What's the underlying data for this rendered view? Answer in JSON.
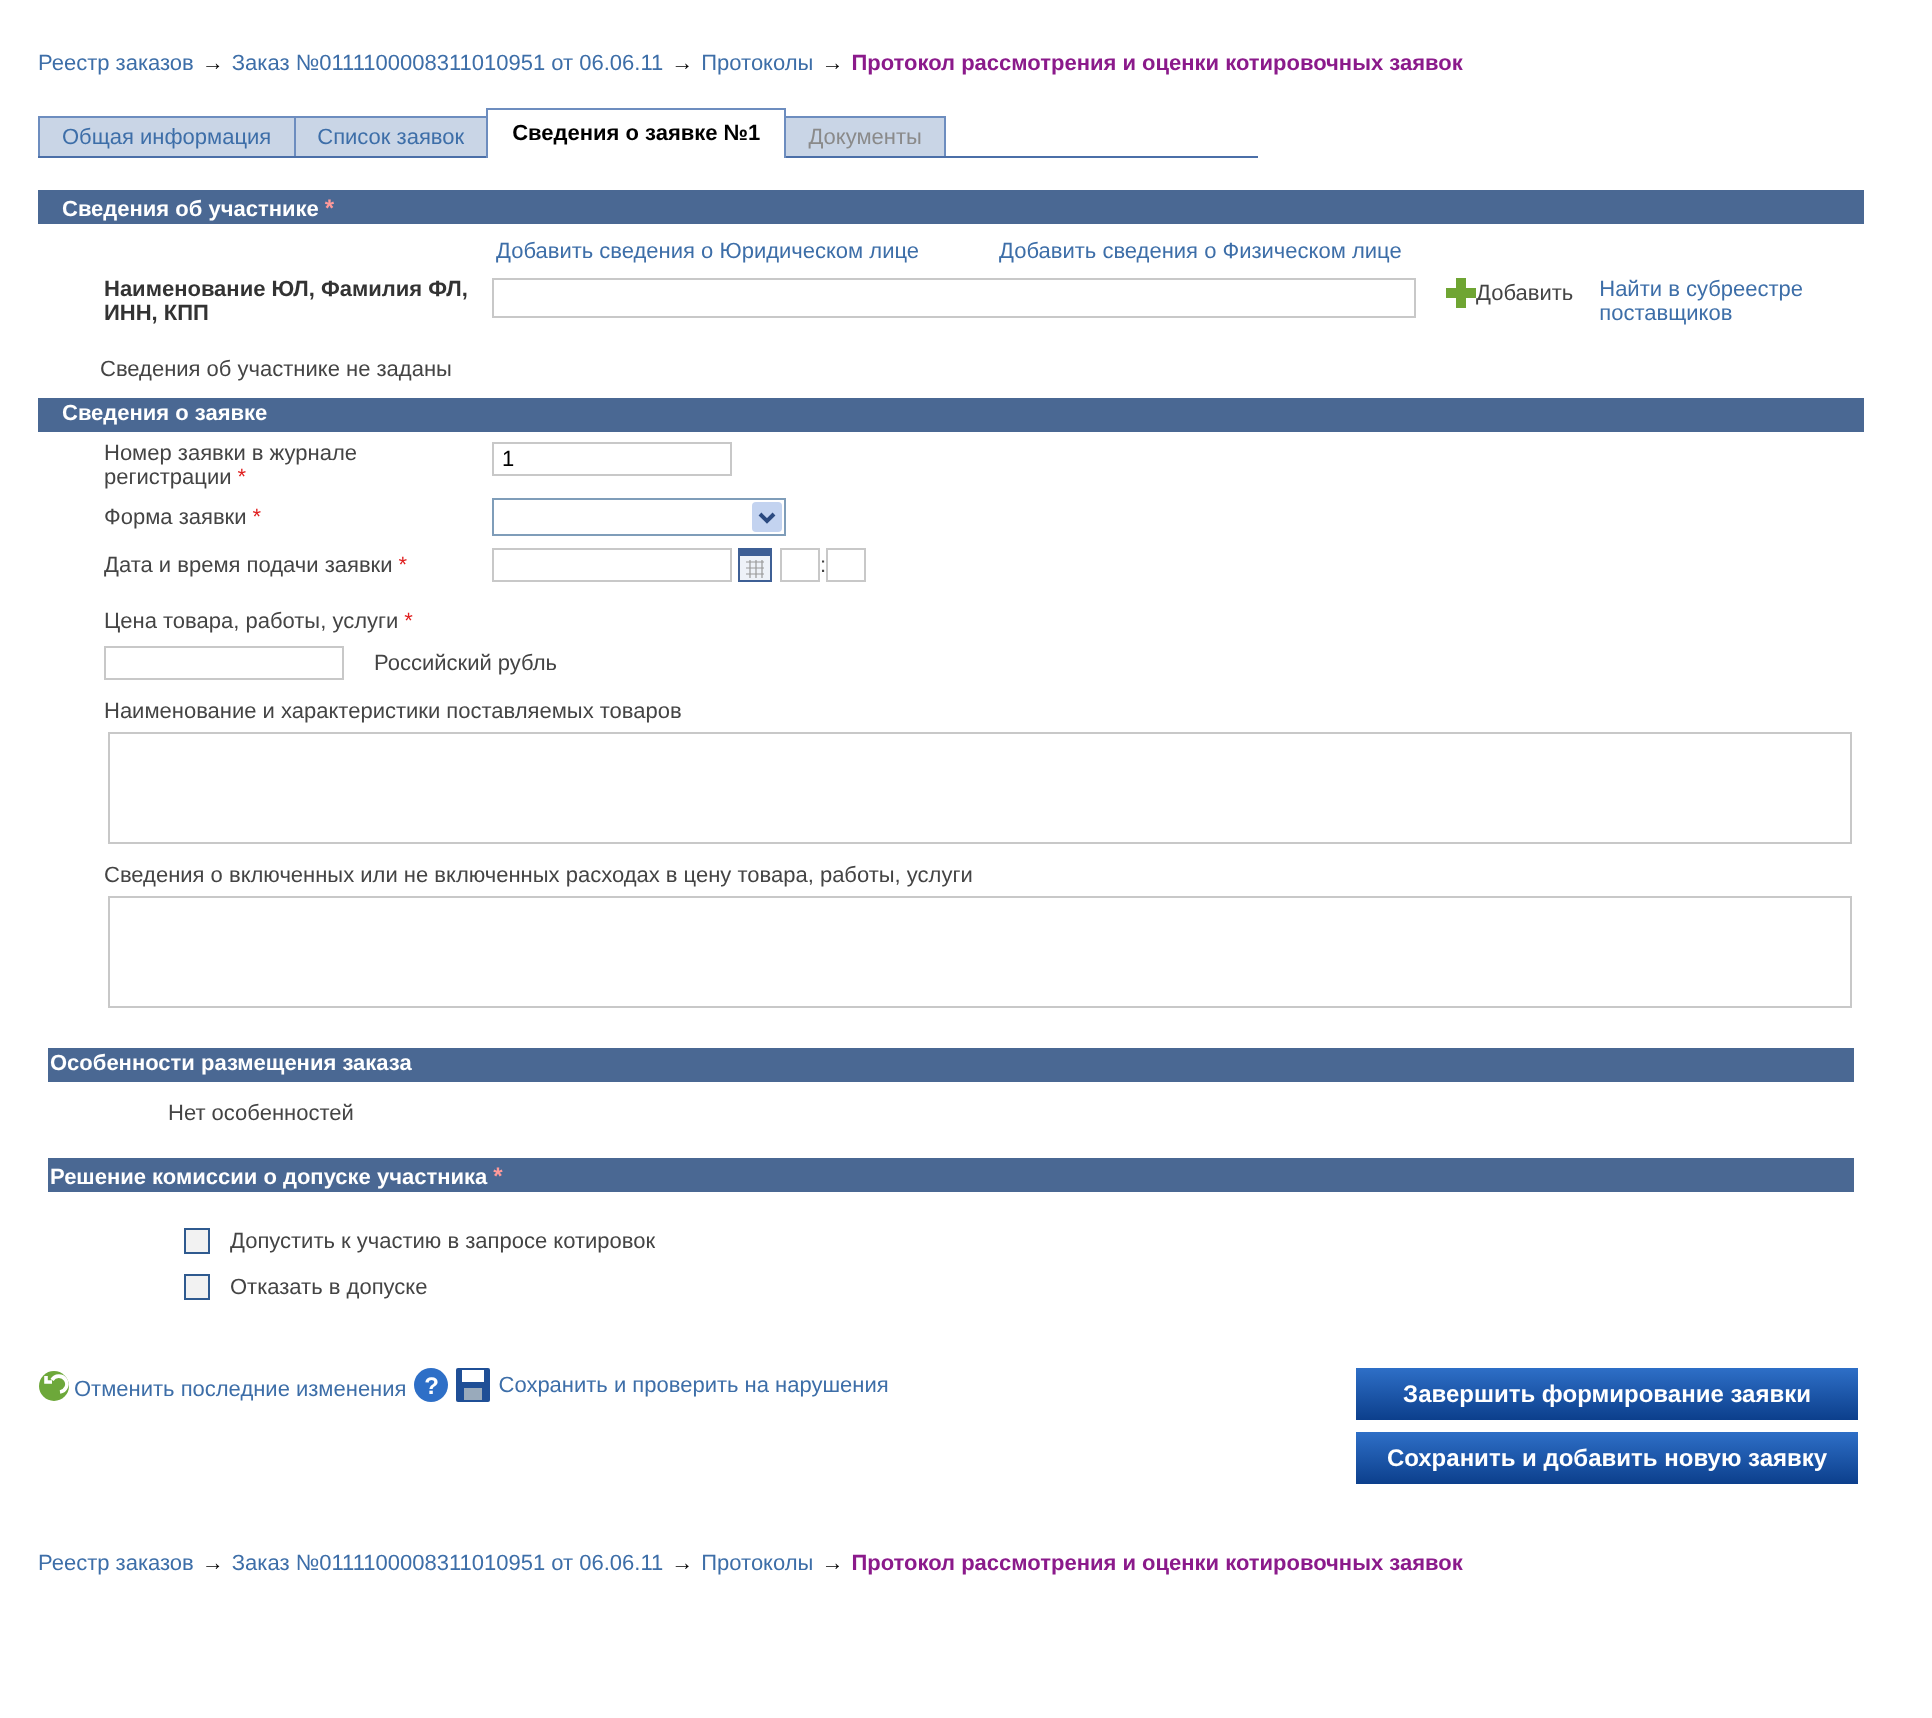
{
  "breadcrumb_top": {
    "arrow": "→",
    "links": [
      "Реестр заказов",
      "Заказ №0111100008311010951 от 06.06.11",
      "Протоколы"
    ],
    "current": "Протокол рассмотрения и оценки котировочных заявок"
  },
  "tabs": [
    {
      "label": "Общая информация",
      "selected": false,
      "disabled": false
    },
    {
      "label": "Список заявок",
      "selected": false,
      "disabled": false
    },
    {
      "label": "Сведения о заявке №1",
      "selected": true,
      "disabled": false
    },
    {
      "label": "Документы",
      "selected": false,
      "disabled": true
    }
  ],
  "participant": {
    "title": "Сведения об участнике",
    "mark": "*",
    "add_links": [
      "Добавить сведения о Юридическом лице",
      "Добавить сведения о Физическом лице"
    ],
    "name_label": "Наименование ЮЛ, Фамилия ФЛ, ИНН, КПП",
    "add_button": "Добавить",
    "find_link": "Найти в субреестре поставщиков",
    "empty_note": "Сведения об участнике не заданы"
  },
  "application": {
    "title": "Сведения о заявке",
    "number_label": "Номер заявки в журнале регистрации",
    "number_mark": "*",
    "number_value": "1",
    "form_label": "Форма заявки",
    "form_mark": "*",
    "date_label": "Дата и время подачи заявки",
    "date_mark": "*",
    "time_separator": ":",
    "price_label": "Цена товара, работы, услуги",
    "price_mark": "*",
    "currency": "Российский рубль",
    "goods_label": "Наименование и характеристики поставляемых товаров",
    "expenses_label": "Сведения о включенных или не включенных расходах в цену товара, работы, услуги"
  },
  "features": {
    "title": "Особенности размещения заказа",
    "note": "Нет особенностей"
  },
  "decision": {
    "title": "Решение комиссии о допуске участника",
    "mark": "*",
    "options": [
      {
        "label": "Допустить к участию в запросе котировок",
        "checked": false
      },
      {
        "label": "Отказать в допуске",
        "checked": false
      }
    ]
  },
  "actions": {
    "undo": "Отменить последние изменения",
    "help": "?",
    "save_check": "Сохранить и проверить на нарушения",
    "buttons": [
      "Завершить формирование заявки",
      "Сохранить и добавить новую заявку"
    ]
  },
  "breadcrumb_bottom": {
    "arrow": "→",
    "links": [
      "Реестр заказов",
      "Заказ №0111100008311010951 от 06.06.11",
      "Протоколы"
    ],
    "current": "Протокол рассмотрения и оценки котировочных заявок"
  }
}
